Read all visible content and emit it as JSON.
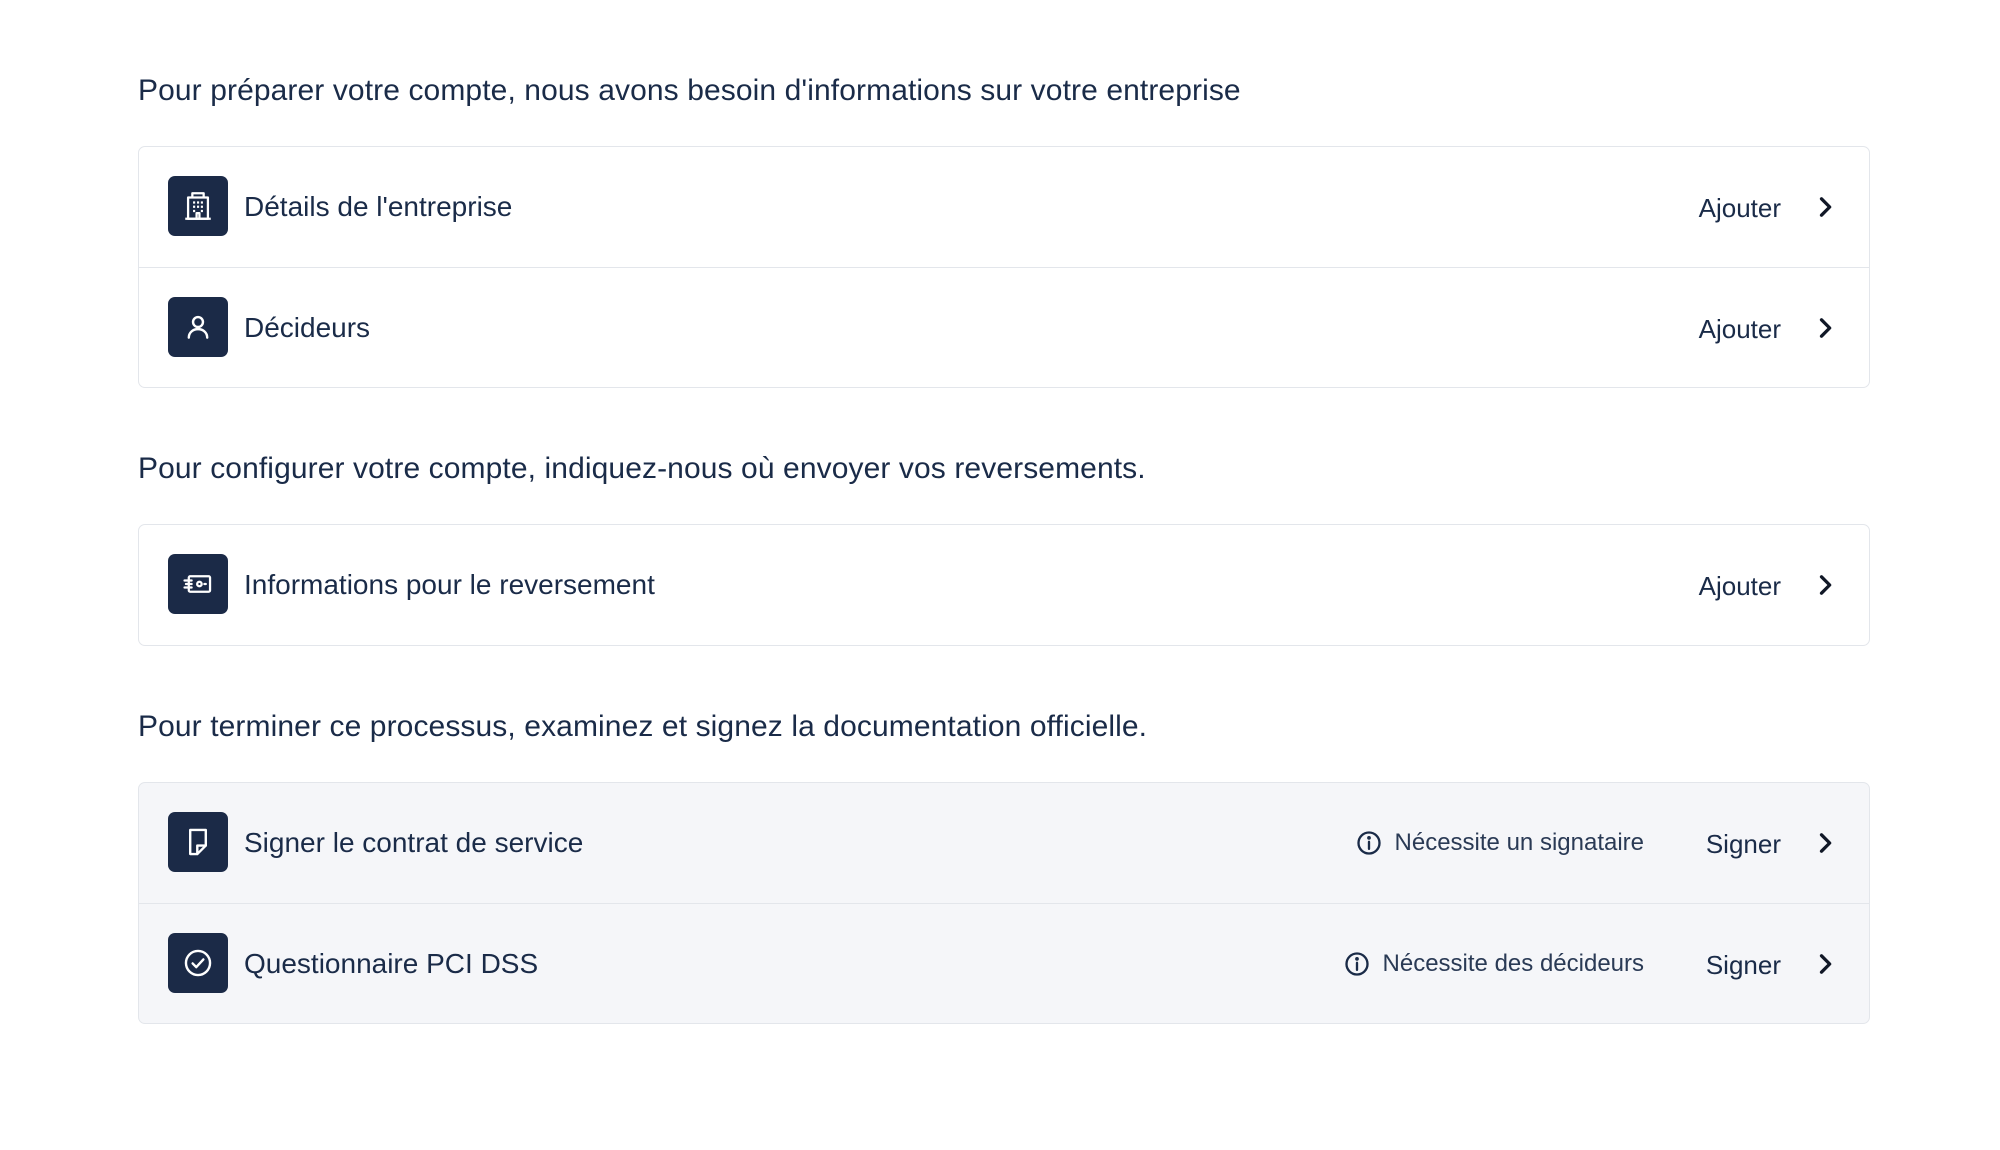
{
  "sections": [
    {
      "title": "Pour préparer votre compte, nous avons besoin d'informations sur votre entreprise",
      "rows": [
        {
          "label": "Détails de l'entreprise",
          "action": "Ajouter",
          "icon": "building-icon"
        },
        {
          "label": "Décideurs",
          "action": "Ajouter",
          "icon": "person-icon"
        }
      ]
    },
    {
      "title": "Pour configurer votre compte, indiquez-nous où envoyer vos reversements.",
      "rows": [
        {
          "label": "Informations pour le reversement",
          "action": "Ajouter",
          "icon": "payout-icon"
        }
      ]
    },
    {
      "title": "Pour terminer ce processus, examinez et signez la documentation officielle.",
      "rows": [
        {
          "label": "Signer le contrat de service",
          "note": "Nécessite un signataire",
          "action": "Signer",
          "icon": "document-icon"
        },
        {
          "label": "Questionnaire PCI DSS",
          "note": "Nécessite des décideurs",
          "action": "Signer",
          "icon": "check-circle-icon"
        }
      ]
    }
  ],
  "colors": {
    "text": "#1a2b48",
    "icon_tile": "#1b2a47",
    "card_border": "#e3e6eb",
    "muted_card_bg": "#f5f6f9"
  }
}
